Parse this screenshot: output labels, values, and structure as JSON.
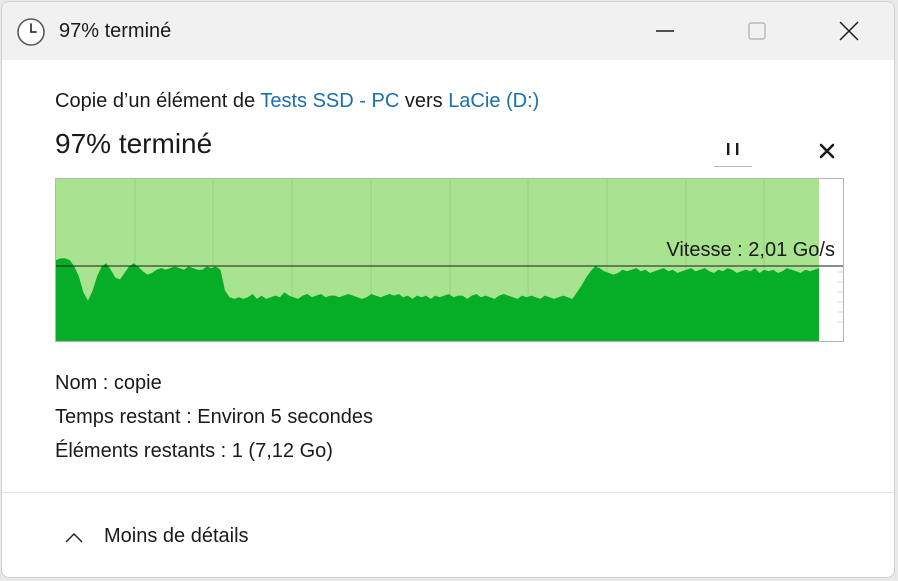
{
  "window": {
    "title": "97% terminé",
    "icons": {
      "app": "clock-icon",
      "minimize": "minimize-icon",
      "maximize": "maximize-icon",
      "close": "close-icon"
    }
  },
  "copy": {
    "prefix": "Copie d’un élément de",
    "source": "Tests SSD - PC",
    "middle": "vers",
    "destination": "LaCie (D:)",
    "link_color": "#1a6fb0"
  },
  "progress": {
    "title": "97% terminé",
    "percent": 97,
    "pause_icon": "pause-icon",
    "cancel_icon": "cancel-icon"
  },
  "graph": {
    "speed_label": "Vitesse : 2,01 Go/s",
    "current_speed_gbps": 2.01,
    "fill_color": "#06ad26",
    "background_fill_color": "#a8e38f",
    "speed_history_relative": [
      0.5,
      0.51,
      0.51,
      0.5,
      0.46,
      0.4,
      0.3,
      0.25,
      0.31,
      0.4,
      0.46,
      0.48,
      0.44,
      0.39,
      0.38,
      0.42,
      0.46,
      0.48,
      0.46,
      0.43,
      0.41,
      0.42,
      0.44,
      0.45,
      0.44,
      0.45,
      0.46,
      0.45,
      0.44,
      0.46,
      0.45,
      0.44,
      0.44,
      0.46,
      0.45,
      0.46,
      0.44,
      0.31,
      0.27,
      0.26,
      0.27,
      0.26,
      0.27,
      0.29,
      0.26,
      0.28,
      0.26,
      0.27,
      0.28,
      0.27,
      0.3,
      0.28,
      0.27,
      0.26,
      0.28,
      0.29,
      0.27,
      0.28,
      0.29,
      0.27,
      0.28,
      0.28,
      0.27,
      0.28,
      0.29,
      0.28,
      0.27,
      0.26,
      0.27,
      0.29,
      0.28,
      0.27,
      0.28,
      0.29,
      0.28,
      0.29,
      0.27,
      0.28,
      0.26,
      0.28,
      0.27,
      0.28,
      0.26,
      0.28,
      0.27,
      0.28,
      0.29,
      0.27,
      0.28,
      0.28,
      0.26,
      0.28,
      0.29,
      0.27,
      0.28,
      0.27,
      0.26,
      0.28,
      0.29,
      0.28,
      0.27,
      0.26,
      0.28,
      0.27,
      0.28,
      0.27,
      0.26,
      0.28,
      0.27,
      0.26,
      0.27,
      0.28,
      0.27,
      0.26,
      0.3,
      0.34,
      0.39,
      0.43,
      0.46,
      0.45,
      0.43,
      0.42,
      0.41,
      0.42,
      0.44,
      0.43,
      0.44,
      0.45,
      0.43,
      0.44,
      0.42,
      0.43,
      0.44,
      0.45,
      0.43,
      0.44,
      0.42,
      0.43,
      0.44,
      0.45,
      0.43,
      0.44,
      0.45,
      0.43,
      0.42,
      0.44,
      0.43,
      0.45,
      0.44,
      0.42,
      0.43,
      0.44,
      0.43,
      0.45,
      0.42,
      0.44,
      0.43,
      0.44,
      0.42,
      0.43,
      0.45,
      0.44,
      0.43,
      0.42,
      0.44,
      0.43,
      0.44,
      0.45
    ]
  },
  "details": {
    "name_label": "Nom :",
    "name_value": "copie",
    "time_label": "Temps restant :",
    "time_value": "Environ 5 secondes",
    "items_label": "Éléments restants :",
    "items_value": "1 (7,12 Go)"
  },
  "footer": {
    "toggle_label": "Moins de détails",
    "toggle_icon": "chevron-up-icon"
  }
}
